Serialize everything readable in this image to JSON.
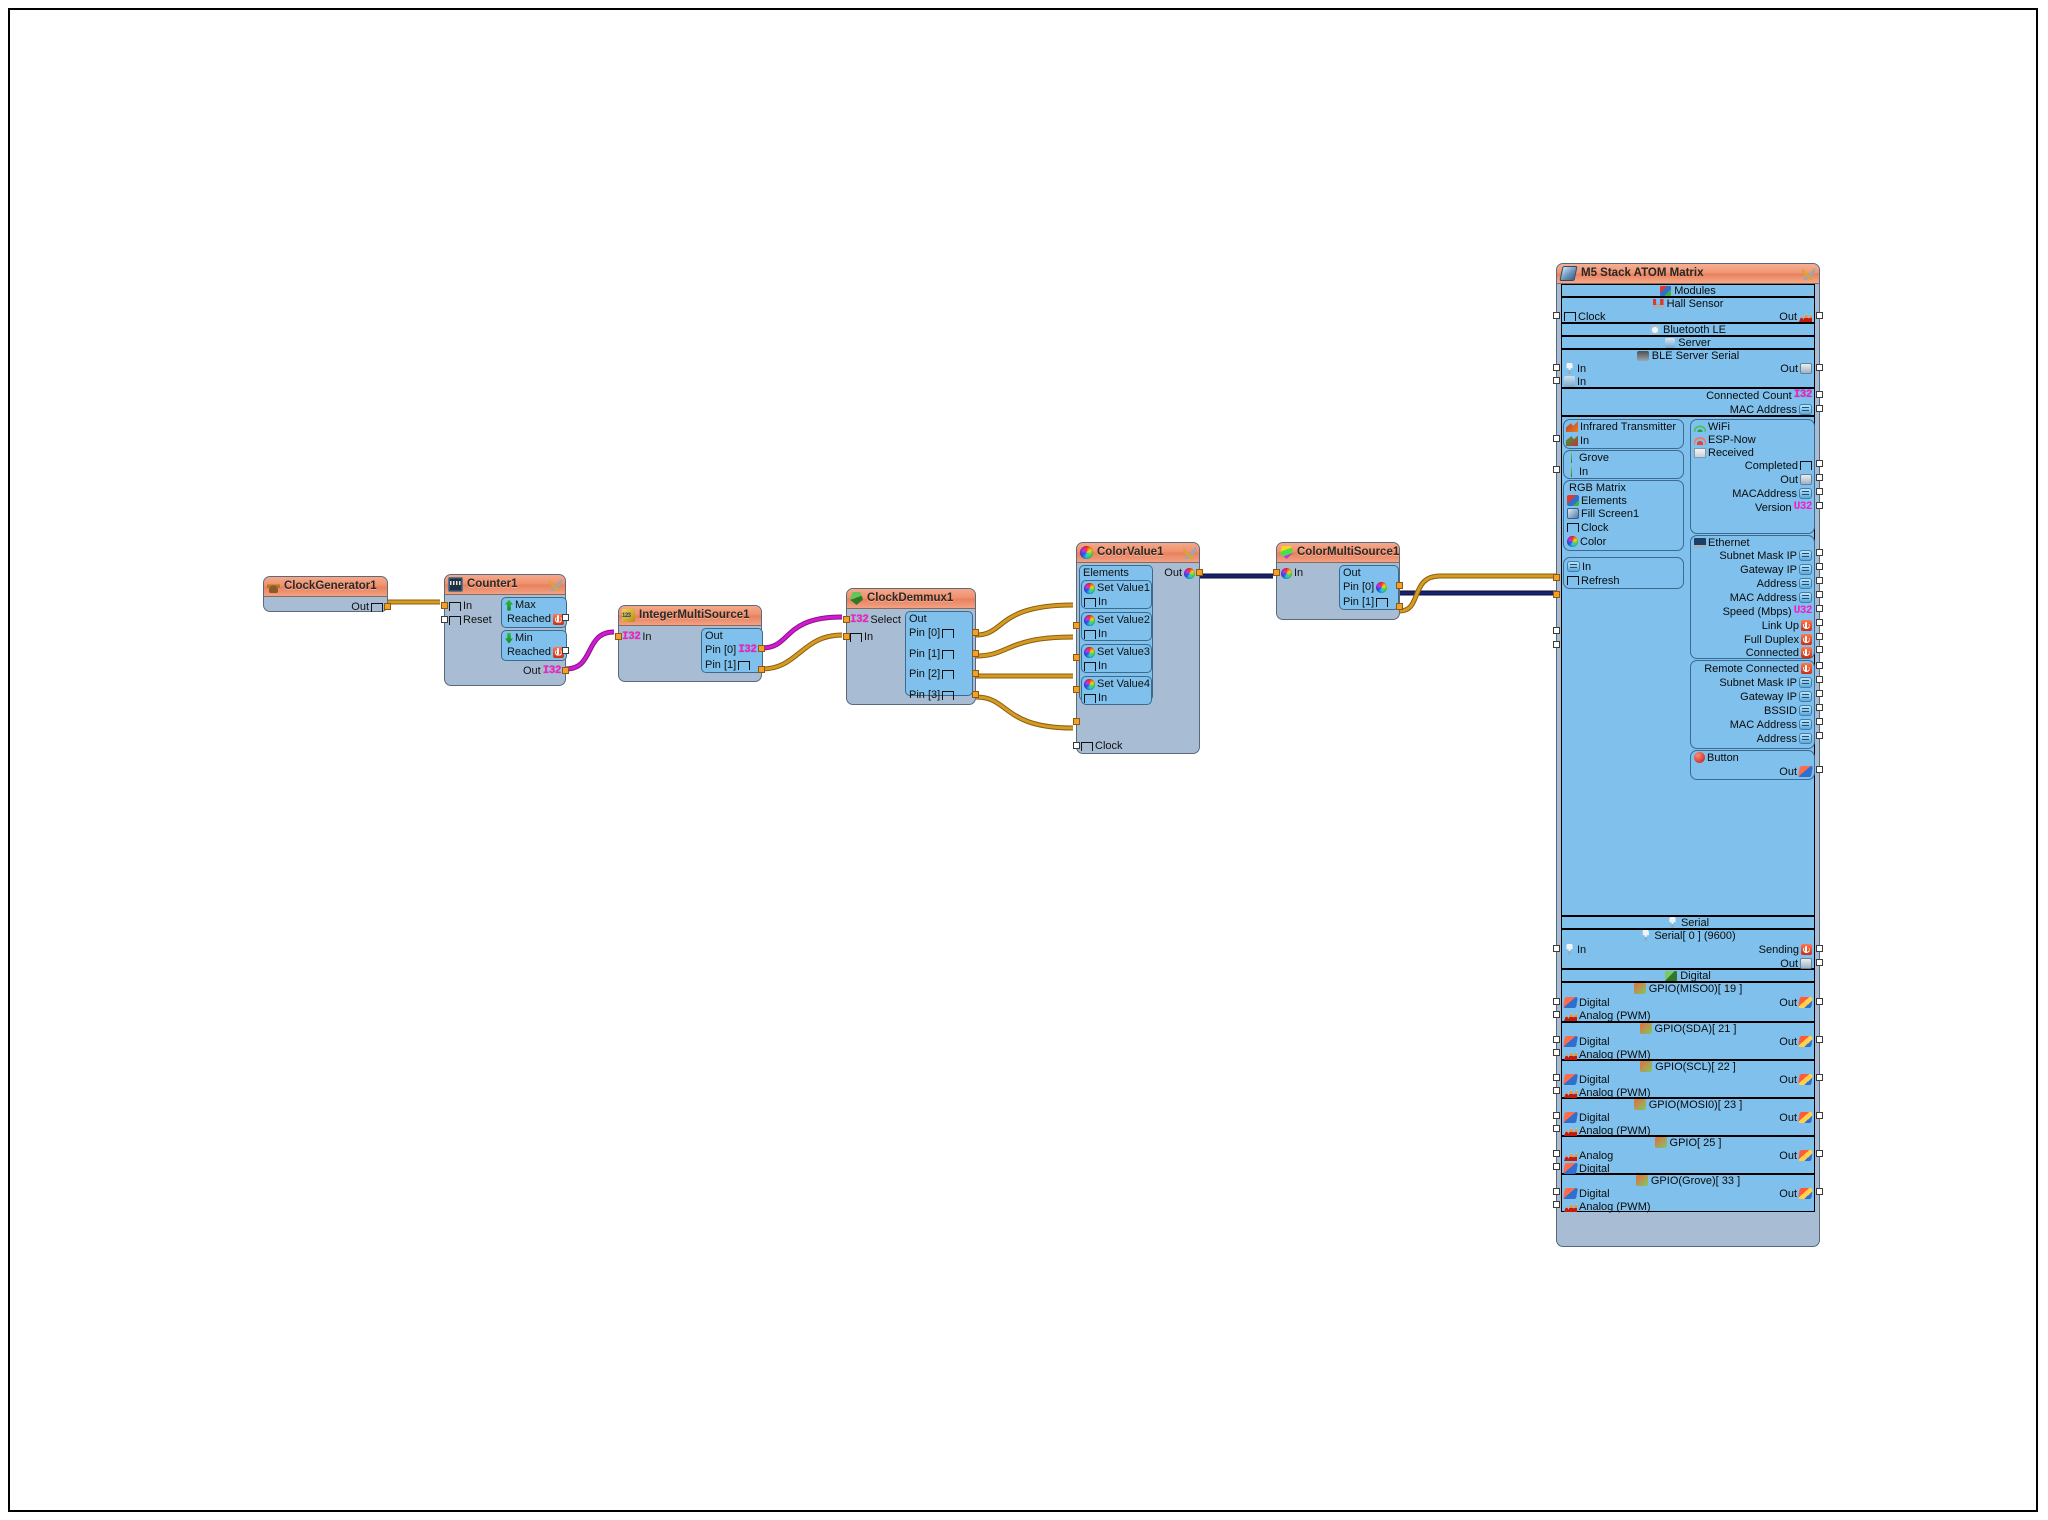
{
  "app": {
    "kind": "visual-dataflow-editor",
    "canvas_background": "#ffffff"
  },
  "palette": {
    "header_orange": "#ef8f6b",
    "node_body_blue": "#a8bdd4",
    "section_blue": "#7fc0ec",
    "wire_clock": "#d59a21",
    "wire_color": "#18216e",
    "wire_integer": "#d11ad1",
    "type_magenta": "#ff16c8"
  },
  "nodes": [
    {
      "id": "clockgenerator1",
      "title": "ClockGenerator1",
      "icon": "clock-generator-icon",
      "has_wrench": false,
      "outputs": [
        {
          "label": "Out",
          "type": "clock"
        }
      ],
      "inputs": []
    },
    {
      "id": "counter1",
      "title": "Counter1",
      "icon": "counter-icon",
      "has_wrench": true,
      "inputs": [
        {
          "label": "In",
          "type": "clock"
        },
        {
          "label": "Reset",
          "type": "clock"
        }
      ],
      "groups": [
        {
          "title": "Max",
          "icon": "arrow-up-icon",
          "pins": [
            {
              "label": "Reached",
              "type": "bool"
            }
          ]
        },
        {
          "title": "Min",
          "icon": "arrow-down-icon",
          "pins": [
            {
              "label": "Reached",
              "type": "bool"
            }
          ]
        }
      ],
      "outputs": [
        {
          "label": "Out",
          "type": "I32"
        }
      ]
    },
    {
      "id": "integermultisource1",
      "title": "IntegerMultiSource1",
      "icon": "integer-source-icon",
      "has_wrench": false,
      "inputs": [
        {
          "label": "In",
          "type": "I32"
        }
      ],
      "out_group": {
        "title": "Out",
        "pins": [
          {
            "label": "Pin [0]",
            "type": "I32"
          },
          {
            "label": "Pin [1]",
            "type": "clock"
          }
        ]
      }
    },
    {
      "id": "clockdemmux1",
      "title": "ClockDemmux1",
      "icon": "demux-icon",
      "has_wrench": false,
      "inputs": [
        {
          "label": "Select",
          "type": "I32"
        },
        {
          "label": "In",
          "type": "clock"
        }
      ],
      "out_group": {
        "title": "Out",
        "pins": [
          {
            "label": "Pin [0]",
            "type": "clock"
          },
          {
            "label": "Pin [1]",
            "type": "clock"
          },
          {
            "label": "Pin [2]",
            "type": "clock"
          },
          {
            "label": "Pin [3]",
            "type": "clock"
          }
        ]
      }
    },
    {
      "id": "colorvalue1",
      "title": "ColorValue1",
      "icon": "color-icon",
      "has_wrench": true,
      "elements_label": "Elements",
      "elements": [
        {
          "title": "Set Value1",
          "pin": {
            "label": "In",
            "type": "clock"
          }
        },
        {
          "title": "Set Value2",
          "pin": {
            "label": "In",
            "type": "clock"
          }
        },
        {
          "title": "Set Value3",
          "pin": {
            "label": "In",
            "type": "clock"
          }
        },
        {
          "title": "Set Value4",
          "pin": {
            "label": "In",
            "type": "clock"
          }
        }
      ],
      "extra_inputs": [
        {
          "label": "Clock",
          "type": "clock"
        }
      ],
      "outputs": [
        {
          "label": "Out",
          "type": "color"
        }
      ]
    },
    {
      "id": "colormultisource1",
      "title": "ColorMultiSource1",
      "icon": "color-multi-icon",
      "has_wrench": false,
      "inputs": [
        {
          "label": "In",
          "type": "color"
        }
      ],
      "out_group": {
        "title": "Out",
        "pins": [
          {
            "label": "Pin [0]",
            "type": "color"
          },
          {
            "label": "Pin [1]",
            "type": "clock"
          }
        ]
      }
    }
  ],
  "board": {
    "title": "M5 Stack ATOM Matrix",
    "icon": "board-icon",
    "wrench": "wrench-icon",
    "sections": [
      {
        "id": "modules",
        "heading": "Modules",
        "heading_icon": "modules-icon",
        "rows": [
          {
            "kind": "heading",
            "text": "Hall Sensor",
            "icon": "hall-sensor-icon"
          },
          {
            "kind": "pins",
            "left": [
              {
                "label": "Clock",
                "type": "clock"
              }
            ],
            "right": [
              {
                "label": "Out",
                "type": "analog"
              }
            ]
          }
        ]
      },
      {
        "id": "bluetooth",
        "heading": "Bluetooth LE",
        "heading_icon": "bluetooth-icon",
        "rows": [
          {
            "kind": "heading",
            "text": "Server",
            "icon": "bt-server-icon"
          },
          {
            "kind": "heading",
            "text": "BLE Server Serial",
            "icon": "ble-serial-icon"
          },
          {
            "kind": "pins",
            "left": [
              {
                "label": "In",
                "type": "serial"
              }
            ],
            "right": [
              {
                "label": "Out",
                "type": "binary"
              }
            ]
          },
          {
            "kind": "pins",
            "left": [
              {
                "label": "In",
                "type": "bluetooth"
              }
            ],
            "right": []
          },
          {
            "kind": "pins",
            "left": [],
            "right": [
              {
                "label": "Connected Count",
                "type": "I32"
              }
            ]
          },
          {
            "kind": "pins",
            "left": [],
            "right": [
              {
                "label": "MAC Address",
                "type": "text"
              }
            ]
          }
        ]
      }
    ],
    "left_groups": [
      {
        "id": "infrared",
        "title": "Infrared Transmitter",
        "icon": "infrared-icon",
        "pins": [
          {
            "label": "In",
            "type": "infrared"
          }
        ]
      },
      {
        "id": "grove",
        "title": "Grove",
        "icon": "grove-icon",
        "pins": [
          {
            "label": "In",
            "type": "grove"
          }
        ]
      },
      {
        "id": "rgbmatrix",
        "title": "RGB Matrix",
        "sub": [
          {
            "label": "Elements",
            "icon": "elements-icon"
          },
          {
            "label": "Fill Screen1",
            "icon": "fill-screen-icon"
          }
        ],
        "pins": [
          {
            "label": "Clock",
            "type": "clock",
            "connected": true
          },
          {
            "label": "Color",
            "type": "color",
            "connected": true
          }
        ]
      },
      {
        "id": "rgbmatrix-io",
        "title": "",
        "pins": [
          {
            "label": "In",
            "type": "text"
          },
          {
            "label": "Refresh",
            "type": "clock"
          }
        ]
      }
    ],
    "right_groups": [
      {
        "id": "wifi",
        "title": "WiFi",
        "icon": "wifi-icon",
        "sub": [
          {
            "label": "ESP-Now",
            "icon": "esp-now-icon"
          },
          {
            "label": "Received",
            "icon": "received-icon"
          }
        ],
        "pins": [
          {
            "label": "Completed",
            "type": "clock"
          },
          {
            "label": "Out",
            "type": "binary"
          },
          {
            "label": "MACAddress",
            "type": "text"
          },
          {
            "label": "Version",
            "type": "U32"
          }
        ]
      },
      {
        "id": "ethernet",
        "title": "Ethernet",
        "icon": "ethernet-icon",
        "pins": [
          {
            "label": "Subnet Mask IP",
            "type": "text"
          },
          {
            "label": "Gateway IP",
            "type": "text"
          },
          {
            "label": "Address",
            "type": "text"
          },
          {
            "label": "MAC Address",
            "type": "text"
          },
          {
            "label": "Speed (Mbps)",
            "type": "U32"
          },
          {
            "label": "Link Up",
            "type": "bool"
          },
          {
            "label": "Full Duplex",
            "type": "bool"
          },
          {
            "label": "Connected",
            "type": "bool"
          }
        ]
      },
      {
        "id": "remote",
        "title": "",
        "pins": [
          {
            "label": "Remote Connected",
            "type": "bool"
          },
          {
            "label": "Subnet Mask IP",
            "type": "text"
          },
          {
            "label": "Gateway IP",
            "type": "text"
          },
          {
            "label": "BSSID",
            "type": "text"
          },
          {
            "label": "MAC Address",
            "type": "text"
          },
          {
            "label": "Address",
            "type": "text"
          }
        ]
      },
      {
        "id": "button",
        "title": "Button",
        "icon": "button-icon",
        "pins": [
          {
            "label": "Out",
            "type": "digital"
          }
        ]
      }
    ],
    "serial_section": {
      "heading": "Serial",
      "heading_icon": "serial-icon",
      "sub_heading": "Serial[ 0 ] (9600)",
      "sub_heading_icon": "serial-icon",
      "left": [
        {
          "label": "In",
          "type": "serial"
        }
      ],
      "right": [
        {
          "label": "Sending",
          "type": "bool"
        },
        {
          "label": "Out",
          "type": "binary"
        }
      ]
    },
    "digital_section": {
      "heading": "Digital",
      "heading_icon": "digital-icon",
      "gpios": [
        {
          "name": "GPIO(MISO0)[ 19 ]",
          "left": [
            "Digital",
            "Analog (PWM)"
          ],
          "right": "Out"
        },
        {
          "name": "GPIO(SDA)[ 21 ]",
          "left": [
            "Digital",
            "Analog (PWM)"
          ],
          "right": "Out"
        },
        {
          "name": "GPIO(SCL)[ 22 ]",
          "left": [
            "Digital",
            "Analog (PWM)"
          ],
          "right": "Out"
        },
        {
          "name": "GPIO(MOSI0)[ 23 ]",
          "left": [
            "Digital",
            "Analog (PWM)"
          ],
          "right": "Out"
        },
        {
          "name": "GPIO[ 25 ]",
          "left": [
            "Analog",
            "Digital"
          ],
          "right": "Out"
        },
        {
          "name": "GPIO(Grove)[ 33 ]",
          "left": [
            "Digital",
            "Analog (PWM)"
          ],
          "right": "Out"
        }
      ]
    }
  },
  "connections": [
    {
      "from": "clockgenerator1.Out",
      "to": "counter1.In",
      "type": "clock"
    },
    {
      "from": "counter1.Out",
      "to": "integermultisource1.In",
      "type": "integer"
    },
    {
      "from": "integermultisource1.Pin[0]",
      "to": "clockdemmux1.Select",
      "type": "integer"
    },
    {
      "from": "integermultisource1.Pin[1]",
      "to": "clockdemmux1.In",
      "type": "clock"
    },
    {
      "from": "clockdemmux1.Pin[0]",
      "to": "colorvalue1.SetValue1.In",
      "type": "clock"
    },
    {
      "from": "clockdemmux1.Pin[1]",
      "to": "colorvalue1.SetValue2.In",
      "type": "clock"
    },
    {
      "from": "clockdemmux1.Pin[2]",
      "to": "colorvalue1.SetValue3.In",
      "type": "clock"
    },
    {
      "from": "clockdemmux1.Pin[3]",
      "to": "colorvalue1.SetValue4.In",
      "type": "clock"
    },
    {
      "from": "colorvalue1.Out",
      "to": "colormultisource1.In",
      "type": "color"
    },
    {
      "from": "colormultisource1.Pin[0]",
      "to": "board.RGBMatrix.Color",
      "type": "color"
    },
    {
      "from": "colormultisource1.Pin[1]",
      "to": "board.RGBMatrix.Clock",
      "type": "clock"
    }
  ]
}
